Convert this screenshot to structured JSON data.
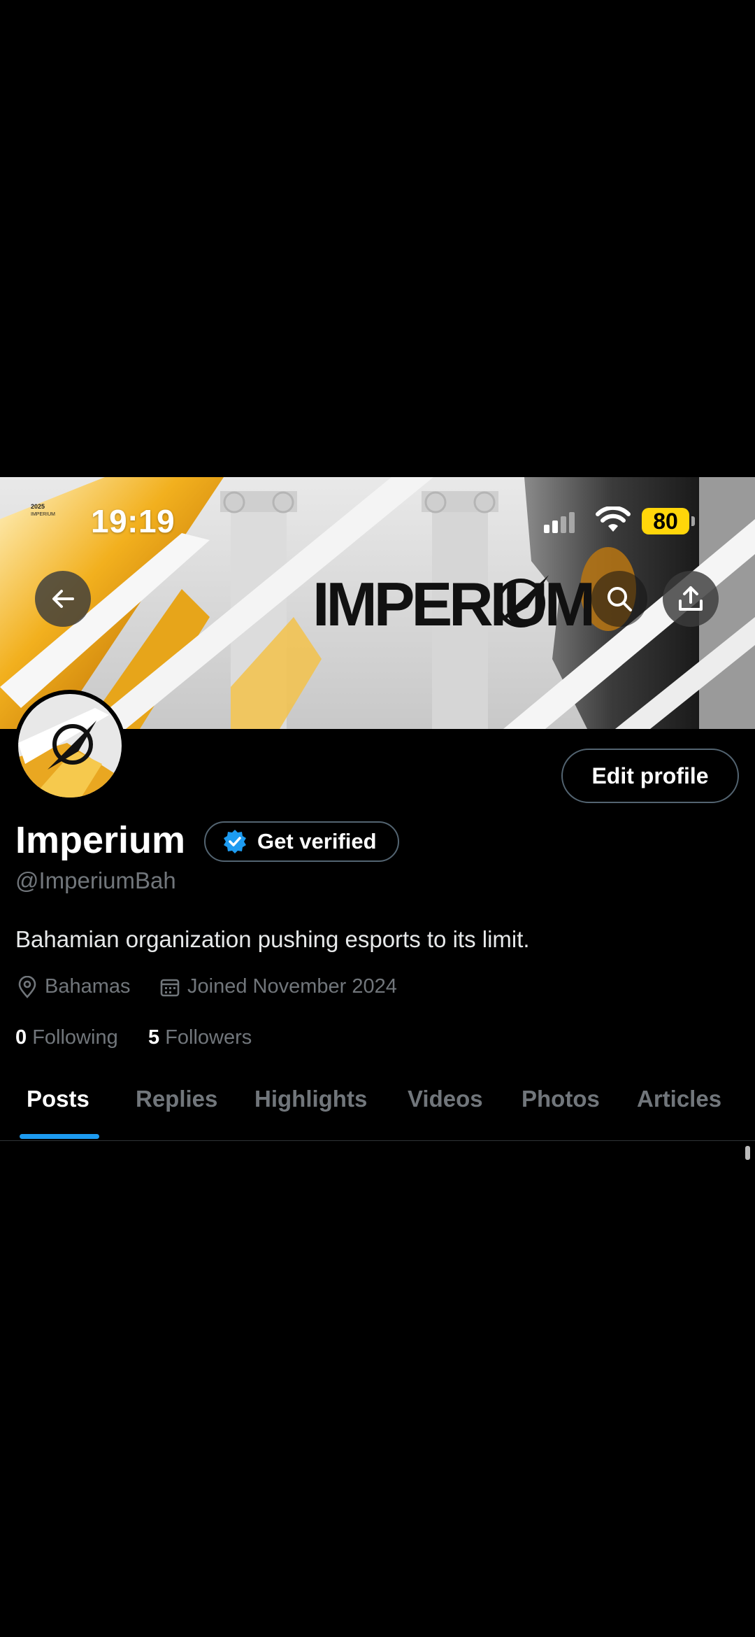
{
  "status_bar": {
    "time": "19:19",
    "battery_level": "80"
  },
  "banner": {
    "brand_text": "IMPERIUM",
    "small_year": "2025",
    "small_name": "IMPERIUM"
  },
  "buttons": {
    "back_icon": "arrow-left-icon",
    "search_icon": "search-icon",
    "share_icon": "share-icon",
    "edit_profile": "Edit profile",
    "get_verified": "Get verified"
  },
  "profile": {
    "display_name": "Imperium",
    "handle": "@ImperiumBah",
    "bio": "Bahamian organization pushing esports to its limit.",
    "location": "Bahamas",
    "joined": "Joined November 2024",
    "following_count": "0",
    "following_label": "Following",
    "followers_count": "5",
    "followers_label": "Followers"
  },
  "tabs": [
    {
      "label": "Posts",
      "active": true
    },
    {
      "label": "Replies"
    },
    {
      "label": "Highlights"
    },
    {
      "label": "Videos"
    },
    {
      "label": "Photos"
    },
    {
      "label": "Articles"
    }
  ],
  "colors": {
    "accent": "#1d9bf0",
    "verified": "#1d9bf0",
    "battery": "#ffd60a",
    "muted": "#71767b",
    "background": "#000000"
  }
}
